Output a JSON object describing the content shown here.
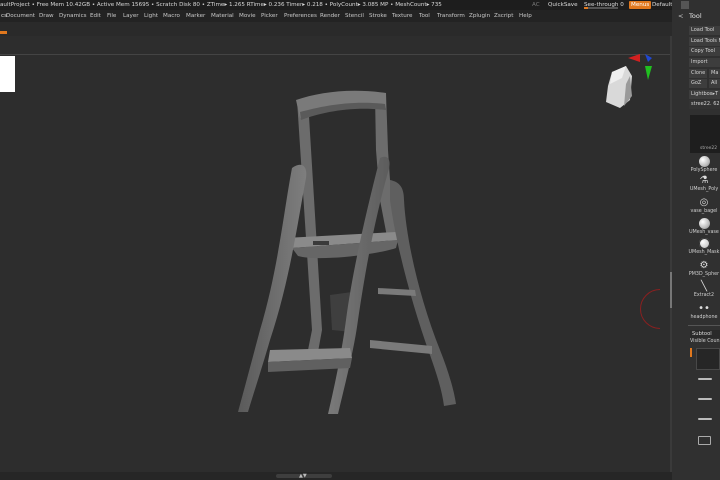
{
  "topbar": {
    "stats": "aultProject  • Free Mem 10.42GB • Active Mem 15695 • Scratch Disk 80 • ZTime▸ 1.265 RTime▸ 0.236 Timer▸ 0.218 • PolyCount▸ 3.085 MP • MeshCount▸ 735",
    "ac": "AC",
    "quicksave": "QuickSave",
    "see_through": "See-through  0",
    "see_through_value": 0,
    "menus": "Menus",
    "default_zscript": "DefaultZScript"
  },
  "menubar": {
    "tab_fragment": "cs",
    "items": [
      "Document",
      "Draw",
      "Dynamics",
      "Edit",
      "File",
      "Layer",
      "Light",
      "Macro",
      "Marker",
      "Material",
      "Movie",
      "Picker",
      "Preferences",
      "Render",
      "Stencil",
      "Stroke",
      "Texture",
      "Tool",
      "Transform",
      "Zplugin",
      "Zscript",
      "Help"
    ]
  },
  "canvas": {
    "bottom_handle": "▲▼"
  },
  "tool_panel": {
    "title": "Tool",
    "title_icon": "<",
    "buttons": {
      "load_tool": "Load Tool",
      "load_tools_from": "Load Tools F",
      "copy_tool": "Copy Tool",
      "import": "Import",
      "clone": "Clone",
      "make": "Ma",
      "goz": "GoZ",
      "all": "All",
      "lightbox": "Lightbox▸T",
      "current_tool": "stree22. 62"
    },
    "thumbnail_label": "stree22",
    "tools": [
      {
        "label": "PolySphere",
        "icon": "sphere-icon"
      },
      {
        "label": "UMesh_Poly",
        "icon": "umesh-icon"
      },
      {
        "label": "vase_bagel",
        "icon": "ring-icon"
      },
      {
        "label": "UMesh_vase",
        "icon": "sphere-icon"
      },
      {
        "label": "UMesh_Mask",
        "icon": "masked-sphere-icon"
      },
      {
        "label": "PM3D_Spher",
        "icon": "gear-sphere-icon"
      },
      {
        "label": "Extract2",
        "icon": "extract-icon"
      },
      {
        "label": "headphone",
        "icon": "headphone-icon"
      }
    ],
    "subtool_title": "Subtool",
    "visible_count": "Visible Coun"
  }
}
